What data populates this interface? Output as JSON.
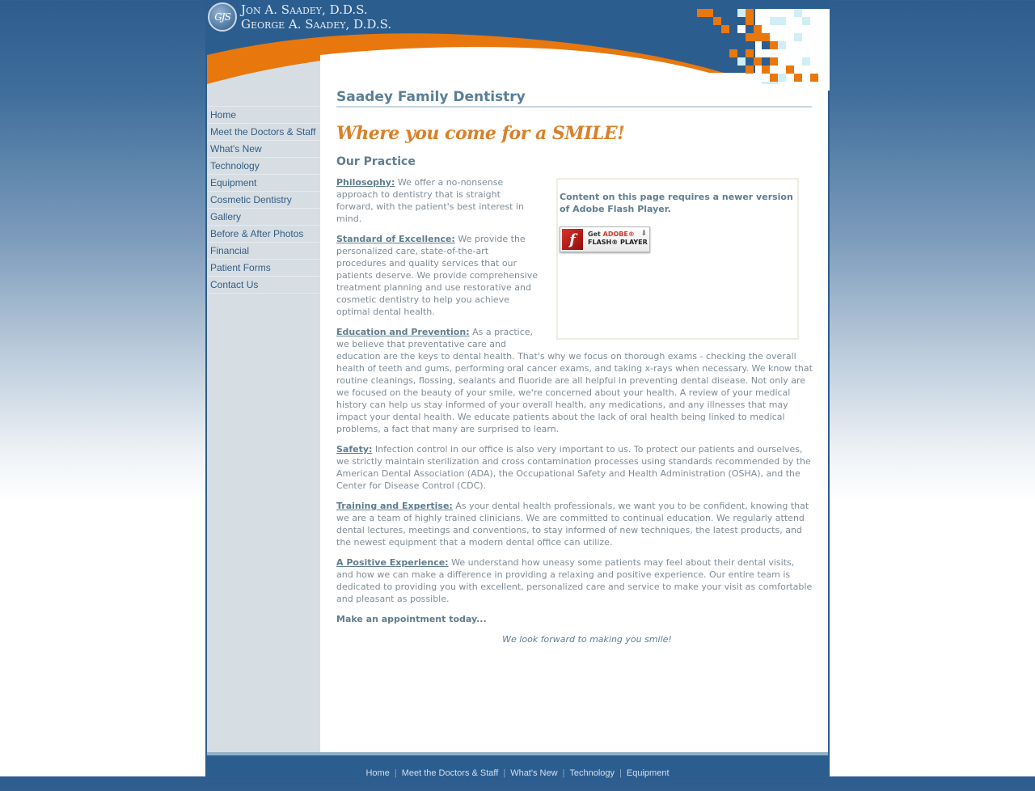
{
  "header": {
    "logo_monogram": "GJS",
    "doctor_1": "Jon A. Saadey, D.D.S.",
    "doctor_2": "George A. Saadey, D.D.S."
  },
  "colors": {
    "brand_blue": "#2c5d8f",
    "accent_orange": "#e8780e",
    "tagline_orange": "#d9802a",
    "heading_slate": "#5f7d8f",
    "sidebar_bg": "#d6dee3",
    "nav_link": "#355c84",
    "body_text": "#7e8c96"
  },
  "sidebar": {
    "items": [
      {
        "label": "Home"
      },
      {
        "label": "Meet the Doctors & Staff"
      },
      {
        "label": "What's New"
      },
      {
        "label": "Technology"
      },
      {
        "label": "Equipment"
      },
      {
        "label": "Cosmetic Dentistry"
      },
      {
        "label": "Gallery"
      },
      {
        "label": "Before & After Photos"
      },
      {
        "label": "Financial"
      },
      {
        "label": "Patient Forms"
      },
      {
        "label": "Contact Us"
      }
    ]
  },
  "main": {
    "site_title": "Saadey Family Dentistry",
    "tagline": "Where you come for a SMILE!",
    "section_heading": "Our Practice",
    "flash": {
      "message": "Content on this page requires a newer version of Adobe Flash Player.",
      "button_get": "Get",
      "button_adobe": "ADOBE®",
      "button_player": "FLASH® PLAYER",
      "icon_glyph": "f"
    },
    "paragraphs": [
      {
        "lead": "Philosophy:",
        "text": " We offer a no-nonsense approach to dentistry that is straight forward, with the patient's best interest in mind."
      },
      {
        "lead": "Standard of Excellence:",
        "text": " We provide the personalized care, state-of-the-art procedures and quality services that our patients deserve. We provide comprehensive treatment planning and use restorative and cosmetic dentistry to help you achieve optimal dental health."
      },
      {
        "lead": "Education and Prevention:",
        "text": " As a practice, we believe that preventative care and education are the keys to dental health. That's why we focus on thorough exams - checking the overall health of teeth and gums, performing oral cancer exams, and taking x-rays when necessary. We know that routine cleanings, flossing, sealants and fluoride are all helpful in preventing dental disease. Not only are we focused on the beauty of your smile, we're concerned about your health. A review of your medical history can help us stay informed of your overall health, any medications, and any illnesses that may impact your dental health. We educate patients about the lack of oral health being linked to medical problems, a fact that many are surprised to learn."
      },
      {
        "lead": "Safety:",
        "text": " Infection control in our office is also very important to us. To protect our patients and ourselves, we strictly maintain sterilization and cross contamination processes using standards recommended by the American Dental Association (ADA), the Occupational Safety and Health Administration (OSHA), and the Center for Disease Control (CDC)."
      },
      {
        "lead": "Training and Expertise:",
        "text": " As your dental health professionals, we want you to be confident, knowing that we are a team of highly trained clinicians. We are committed to continual education. We regularly attend dental lectures, meetings and conventions, to stay informed of new techniques, the latest products, and the newest equipment that a modern dental office can utilize."
      },
      {
        "lead": "A Positive Experience:",
        "text": " We understand how uneasy some patients may feel about their dental visits, and how we can make a difference in providing a relaxing and positive experience. Our entire team is dedicated to providing you with excellent, personalized care and service to make your visit as comfortable and pleasant as possible."
      }
    ],
    "appointment": "Make an appointment today...",
    "closing": "We look forward to making you smile!"
  },
  "footer": {
    "links": [
      {
        "label": "Home"
      },
      {
        "label": "Meet the Doctors & Staff"
      },
      {
        "label": "What's New"
      },
      {
        "label": "Technology"
      },
      {
        "label": "Equipment"
      }
    ],
    "separator": "|"
  }
}
